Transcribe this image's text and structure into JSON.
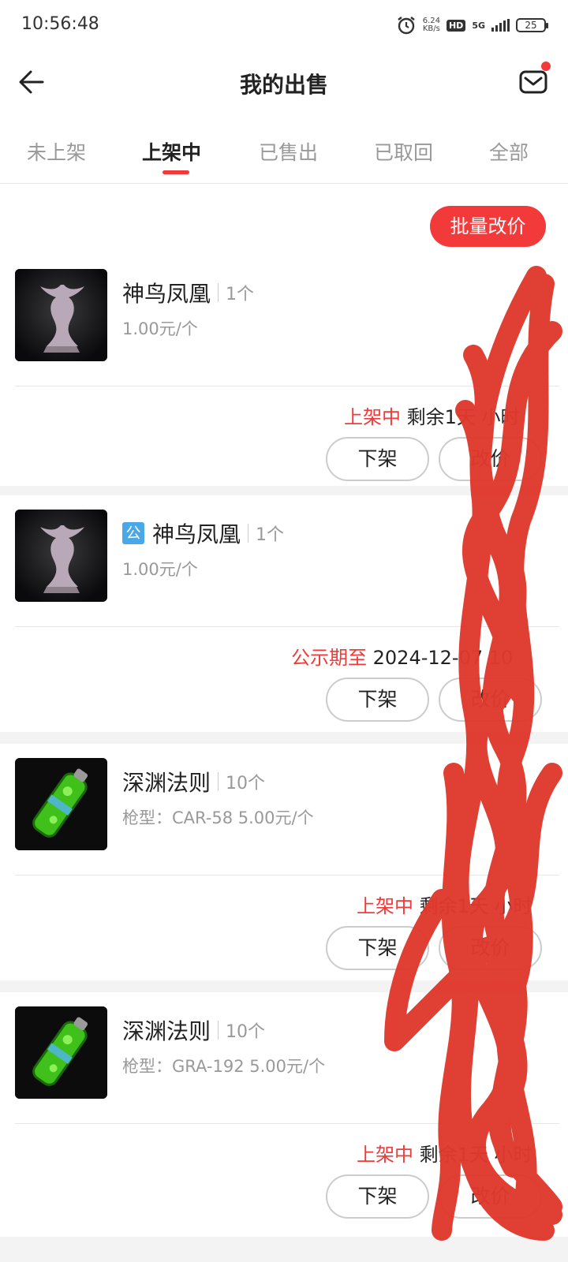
{
  "status_bar": {
    "time": "10:56:48",
    "net_speed": "6.24",
    "net_unit": "KB/s",
    "hd": "HD",
    "network": "5G",
    "battery": "25"
  },
  "header": {
    "title": "我的出售"
  },
  "tabs": [
    {
      "label": "未上架"
    },
    {
      "label": "上架中"
    },
    {
      "label": "已售出"
    },
    {
      "label": "已取回"
    },
    {
      "label": "全部"
    }
  ],
  "active_tab": 1,
  "bulk_label": "批量改价",
  "items": [
    {
      "name": "神鸟凤凰",
      "qty": "1个",
      "price": "1.00元/个",
      "status": "上架中",
      "status_text": "剩余1天 小时",
      "btn_off": "下架",
      "btn_price": "改价",
      "public": false
    },
    {
      "badge": "公",
      "name": "神鸟凤凰",
      "qty": "1个",
      "price": "1.00元/个",
      "status": "公示期至",
      "status_text": "2024-12-07 10",
      "btn_off": "下架",
      "btn_price": "改价",
      "public": true
    },
    {
      "name": "深渊法则",
      "qty": "10个",
      "price": "枪型：CAR-58  5.00元/个",
      "status": "上架中",
      "status_text": "剩余1天 小时",
      "btn_off": "下架",
      "btn_price": "改价",
      "public": false
    },
    {
      "name": "深渊法则",
      "qty": "10个",
      "price": "枪型：GRA-192  5.00元/个",
      "status": "上架中",
      "status_text": "剩余1天 小时",
      "btn_off": "下架",
      "btn_price": "改价",
      "public": false
    }
  ],
  "colors": {
    "accent": "#f23a3a",
    "scribble": "#e0392d",
    "public_badge": "#4aa8e8"
  }
}
